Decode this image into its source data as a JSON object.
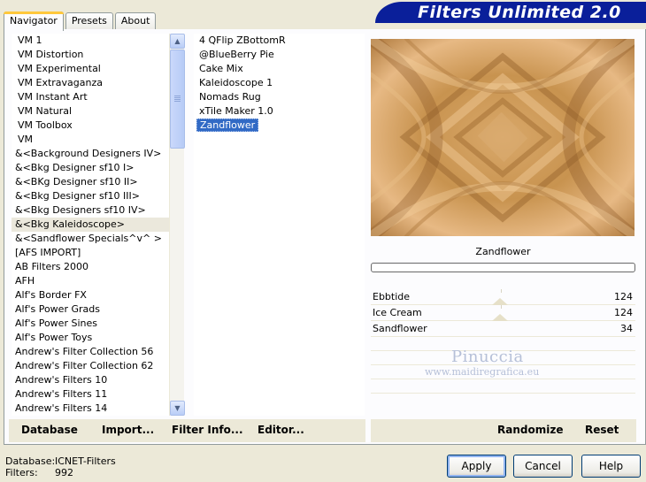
{
  "window": {
    "title": "Filters Unlimited 2.0"
  },
  "tabs": [
    {
      "label": "Navigator",
      "active": true
    },
    {
      "label": "Presets",
      "active": false
    },
    {
      "label": "About",
      "active": false
    }
  ],
  "categories": [
    "VM 1",
    "VM Distortion",
    "VM Experimental",
    "VM Extravaganza",
    "VM Instant Art",
    "VM Natural",
    "VM Toolbox",
    "VM",
    "&<Background Designers IV>",
    "&<Bkg Designer sf10 I>",
    "&<BKg Designer sf10 II>",
    "&<Bkg Designer sf10 III>",
    "&<Bkg Designers sf10 IV>",
    "&<Bkg Kaleidoscope>",
    "&<Sandflower Specials^v^ >",
    "[AFS IMPORT]",
    "AB Filters 2000",
    "AFH",
    "Alf's Border FX",
    "Alf's Power Grads",
    "Alf's Power Sines",
    "Alf's Power Toys",
    "Andrew's Filter Collection 56",
    "Andrew's Filter Collection 62",
    "Andrew's Filters 10",
    "Andrew's Filters 11",
    "Andrew's Filters 14"
  ],
  "selected_category": "&<Bkg Kaleidoscope>",
  "filters": [
    "4 QFlip ZBottomR",
    "@BlueBerry Pie",
    "Cake Mix",
    "Kaleidoscope 1",
    "Nomads Rug",
    "xTile Maker 1.0",
    "Zandflower"
  ],
  "selected_filter": "Zandflower",
  "preview": {
    "filter_name": "Zandflower",
    "progress": 0
  },
  "sliders": [
    {
      "name": "Ebbtide",
      "value": "124"
    },
    {
      "name": "Ice Cream",
      "value": "124"
    },
    {
      "name": "Sandflower",
      "value": "34"
    }
  ],
  "toolbar": {
    "database": "Database",
    "import": "Import...",
    "filter_info": "Filter Info...",
    "editor": "Editor...",
    "randomize": "Randomize",
    "reset": "Reset"
  },
  "watermark": {
    "name": "Pinuccia",
    "url": "www.maidiregrafica.eu"
  },
  "status": {
    "database_label": "Database:",
    "database_value": "ICNET-Filters",
    "filters_label": "Filters:",
    "filters_value": "992"
  },
  "buttons": {
    "apply": "Apply",
    "cancel": "Cancel",
    "help": "Help"
  },
  "colors": {
    "banner": "#0a1f9a",
    "selection": "#316ac5",
    "background": "#ece9d8"
  }
}
